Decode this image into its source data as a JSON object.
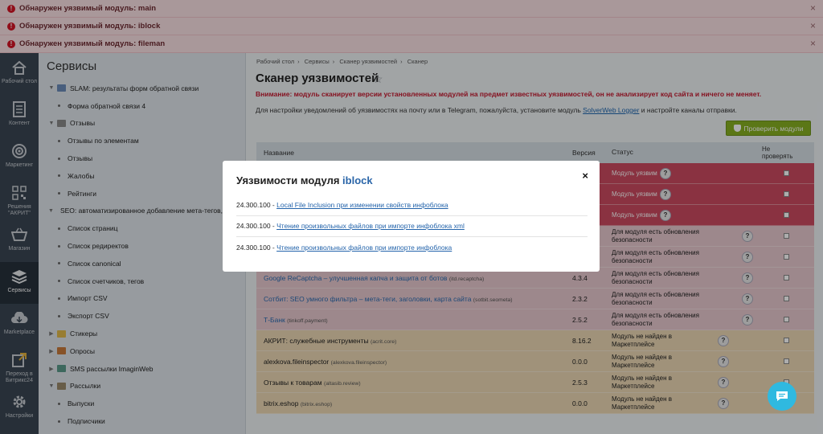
{
  "alerts": [
    {
      "text": "Обнаружен уязвимый модуль: main"
    },
    {
      "text": "Обнаружен уязвимый модуль: iblock"
    },
    {
      "text": "Обнаружен уязвимый модуль: fileman"
    }
  ],
  "leftbar": [
    {
      "label": "Рабочий стол",
      "icon": "home-icon"
    },
    {
      "label": "Контент",
      "icon": "document-icon"
    },
    {
      "label": "Маркетинг",
      "icon": "target-icon"
    },
    {
      "label": "Решения \"АКРИТ\"",
      "icon": "qr-icon"
    },
    {
      "label": "Магазин",
      "icon": "basket-icon"
    },
    {
      "label": "Сервисы",
      "icon": "layers-icon",
      "active": true
    },
    {
      "label": "Marketplace",
      "icon": "cloud-download-icon"
    },
    {
      "label": "Переход в Битрикс24",
      "icon": "transfer-icon"
    },
    {
      "label": "Настройки",
      "icon": "gear-icon"
    }
  ],
  "menu": {
    "title": "Сервисы",
    "items": [
      {
        "label": "SLAM: результаты форм обратной связи",
        "level": 1,
        "arrow": "▼",
        "icon": "mail-icon"
      },
      {
        "label": "Форма обратной связи 4",
        "level": 2
      },
      {
        "label": "Отзывы",
        "level": 1,
        "arrow": "▼",
        "icon": "reviews-icon"
      },
      {
        "label": "Отзывы по элементам",
        "level": 2
      },
      {
        "label": "Отзывы",
        "level": 2
      },
      {
        "label": "Жалобы",
        "level": 2
      },
      {
        "label": "Рейтинги",
        "level": 2
      },
      {
        "label": "SEO: автоматизированное добавление мета-тегов, редирект",
        "level": 1,
        "arrow": "▼",
        "icon": "seo-icon"
      },
      {
        "label": "Список страниц",
        "level": 2
      },
      {
        "label": "Список редиректов",
        "level": 2
      },
      {
        "label": "Список canonical",
        "level": 2
      },
      {
        "label": "Список счетчиков, тегов",
        "level": 2
      },
      {
        "label": "Импорт CSV",
        "level": 2
      },
      {
        "label": "Экспорт CSV",
        "level": 2
      },
      {
        "label": "Стикеры",
        "level": 1,
        "arrow": "▶",
        "icon": "sticker-icon"
      },
      {
        "label": "Опросы",
        "level": 1,
        "arrow": "▶",
        "icon": "poll-icon"
      },
      {
        "label": "SMS рассылки ImaginWeb",
        "level": 1,
        "arrow": "▶",
        "icon": "sms-icon"
      },
      {
        "label": "Рассылки",
        "level": 1,
        "arrow": "▼",
        "icon": "newsletter-icon"
      },
      {
        "label": "Выпуски",
        "level": 2
      },
      {
        "label": "Подписчики",
        "level": 2
      }
    ]
  },
  "breadcrumbs": [
    "Рабочий стол",
    "Сервисы",
    "Сканер уязвимостей",
    "Сканер"
  ],
  "page": {
    "title": "Сканер уязвимостей",
    "warning": "Внимание: модуль сканирует версии установленных модулей на предмет известных уязвимостей, он не анализирует код сайта и ничего не меняет.",
    "note_before": "Для настройки уведомлений об уязвимостях на почту или в Telegram, пожалуйста, установите модуль ",
    "note_link": "SolverWeb Logger",
    "note_after": " и настройте каналы отправки.",
    "check_button": "Проверить модули"
  },
  "table": {
    "headers": {
      "name": "Название",
      "version": "Версия",
      "status": "Статус",
      "skip": "Не проверять"
    },
    "rows": [
      {
        "name": "",
        "code": "",
        "version": "",
        "status": "Модуль уязвим",
        "tone": "red"
      },
      {
        "name": "",
        "code": "",
        "version": "",
        "status": "Модуль уязвим",
        "tone": "red"
      },
      {
        "name": "",
        "code": "",
        "version": "",
        "status": "Модуль уязвим",
        "tone": "red"
      },
      {
        "name": "",
        "code": "",
        "version": "",
        "status": "Для модуля есть обновления безопасности",
        "tone": "pink"
      },
      {
        "name": "",
        "code": "",
        "version": "",
        "status": "Для модуля есть обновления безопасности",
        "tone": "pink"
      },
      {
        "name": "Google ReCaptcha – улучшенная капча и защита от ботов",
        "code": "(itd.recaptcha)",
        "version": "4.3.4",
        "status": "Для модуля есть обновления безопасности",
        "tone": "pink",
        "link": true
      },
      {
        "name": "Сотбит: SEO умного фильтра – мета-теги, заголовки, карта сайта",
        "code": "(sotbit.seometa)",
        "version": "2.3.2",
        "status": "Для модуля есть обновления безопасности",
        "tone": "pink",
        "link": true
      },
      {
        "name": "Т-Банк",
        "code": "(tinkoff.payment)",
        "version": "2.5.2",
        "status": "Для модуля есть обновления безопасности",
        "tone": "pink",
        "link": true
      },
      {
        "name": "АКРИТ: служебные инструменты",
        "code": "(acrit.core)",
        "version": "8.16.2",
        "status": "Модуль не найден в Маркетплейсе",
        "tone": "yellow"
      },
      {
        "name": "alexkova.fileinspector",
        "code": "(alexkova.fileinspector)",
        "version": "0.0.0",
        "status": "Модуль не найден в Маркетплейсе",
        "tone": "yellow"
      },
      {
        "name": "Отзывы к товарам",
        "code": "(altasib.review)",
        "version": "2.5.3",
        "status": "Модуль не найден в Маркетплейсе",
        "tone": "yellow"
      },
      {
        "name": "bitrix.eshop",
        "code": "(bitrix.eshop)",
        "version": "0.0.0",
        "status": "Модуль не найден в Маркетплейсе",
        "tone": "yellow"
      }
    ]
  },
  "modal": {
    "title_prefix": "Уязвимости модуля ",
    "module": "iblock",
    "close": "×",
    "items": [
      {
        "version": "24.300.100",
        "sep": " - ",
        "text": "Local File Inclusion при изменении свойств инфоблока"
      },
      {
        "version": "24.300.100",
        "sep": " - ",
        "text": "Чтение произвольных файлов при импорте инфоблока xml"
      },
      {
        "version": "24.300.100",
        "sep": " - ",
        "text": "Чтение произвольных файлов при импорте инфоблока"
      }
    ]
  },
  "colors": {
    "alert_bg": "#fae0e3",
    "leftbar_bg": "#3a4653",
    "row_red": "#cc4a60",
    "row_pink": "#e8c9ce",
    "row_yellow": "#ecd8b4",
    "button_green": "#86b021",
    "link_blue": "#2464ab",
    "chat_blue": "#2fb9e0"
  }
}
